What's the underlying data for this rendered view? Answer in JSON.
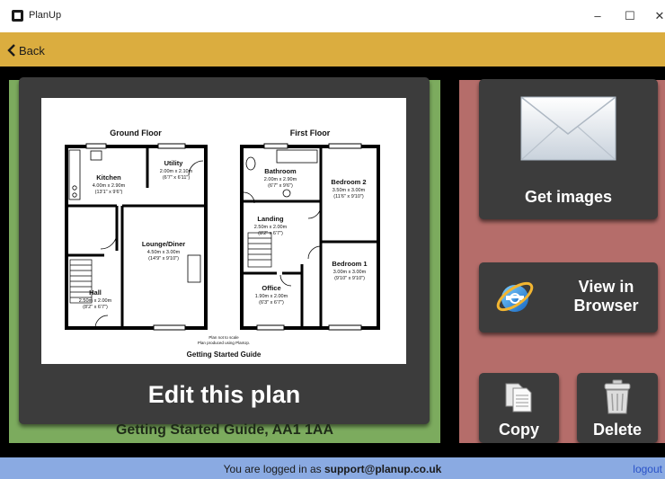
{
  "window": {
    "title": "PlanUp",
    "minimize_glyph": "–",
    "maximize_glyph": "☐",
    "close_glyph": "✕"
  },
  "nav": {
    "back_label": "Back",
    "back_icon": "chevron-left-icon"
  },
  "plan_card": {
    "action_label": "Edit this plan",
    "plan_title": "Getting Started Guide, AA1 1AA",
    "floorplan": {
      "ground_floor_title": "Ground Floor",
      "first_floor_title": "First Floor",
      "rooms": {
        "kitchen": {
          "name": "Kitchen",
          "metric": "4.00m x 2.90m",
          "imperial": "(13'1\" x 9'6\")"
        },
        "utility": {
          "name": "Utility",
          "metric": "2.00m x 2.10m",
          "imperial": "(6'7\" x 6'11\")"
        },
        "lounge": {
          "name": "Lounge/Diner",
          "metric": "4.50m x 3.00m",
          "imperial": "(14'9\" x 9'10\")"
        },
        "hall": {
          "name": "Hall",
          "metric": "2.50m x 2.00m",
          "imperial": "(8'2\" x 6'7\")"
        },
        "bathroom": {
          "name": "Bathroom",
          "metric": "2.00m x 2.90m",
          "imperial": "(6'7\" x 9'6\")"
        },
        "bedroom2": {
          "name": "Bedroom 2",
          "metric": "3.50m x 3.00m",
          "imperial": "(11'6\" x 9'10\")"
        },
        "landing": {
          "name": "Landing",
          "metric": "2.50m x 2.00m",
          "imperial": "(8'2\" x 6'7\")"
        },
        "bedroom1": {
          "name": "Bedroom 1",
          "metric": "3.00m x 3.00m",
          "imperial": "(9'10\" x 9'10\")"
        },
        "office": {
          "name": "Office",
          "metric": "1.90m x 2.00m",
          "imperial": "(6'3\" x 6'7\")"
        }
      },
      "note_scale": "Plan not to scale",
      "note_produced": "Plan produced using PlanUp.",
      "plan_caption": "Getting Started Guide"
    }
  },
  "actions": {
    "get_images": {
      "label": "Get images",
      "icon": "envelope-icon"
    },
    "view_browser": {
      "label_line1": "View in",
      "label_line2": "Browser",
      "icon": "internet-explorer-icon"
    },
    "copy": {
      "label": "Copy",
      "icon": "copy-documents-icon"
    },
    "delete": {
      "label": "Delete",
      "icon": "trash-can-icon"
    }
  },
  "status": {
    "prefix": "You are logged in as ",
    "user_email": "support@planup.co.uk",
    "logout_label": "logout"
  },
  "colors": {
    "back_bar": "#dbad3f",
    "left_panel": "#7cab5e",
    "right_panel": "#b56d6a",
    "tile": "#3c3c3c",
    "status_bar": "#8aaae2",
    "logout_link": "#2a52c8"
  }
}
